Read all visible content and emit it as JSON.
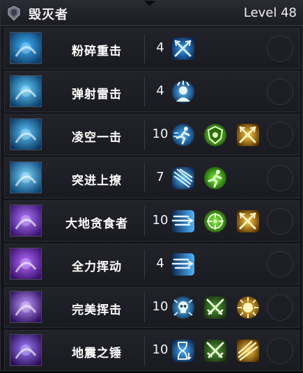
{
  "header": {
    "title": "毁灭者",
    "level": "Level 48"
  },
  "skills": [
    {
      "name": "粉碎重击",
      "value": "4",
      "colors": [
        "#0d3b66",
        "#3fb7ff"
      ],
      "modifiers": [
        "crossed-arrows-icon"
      ]
    },
    {
      "name": "弹射雷击",
      "value": "4",
      "colors": [
        "#0b3f6e",
        "#66d0ff"
      ],
      "modifiers": [
        "stun-head-icon"
      ]
    },
    {
      "name": "凌空一击",
      "value": "10",
      "colors": [
        "#0a3660",
        "#5cc8ff"
      ],
      "modifiers": [
        "running-figure-icon",
        "green-shield-icon",
        "gold-crossed-arrows-icon"
      ]
    },
    {
      "name": "突进上撩",
      "value": "7",
      "colors": [
        "#0d4578",
        "#7ad6ff"
      ],
      "modifiers": [
        "streak-lines-icon",
        "green-runner-icon"
      ]
    },
    {
      "name": "大地贪食者",
      "value": "10",
      "colors": [
        "#3a1170",
        "#b07cff"
      ],
      "modifiers": [
        "speed-lines-icon",
        "green-target-icon",
        "gold-crossed-arrows-icon"
      ]
    },
    {
      "name": "全力挥动",
      "value": "4",
      "colors": [
        "#3c0f6e",
        "#b46cff"
      ],
      "modifiers": [
        "speed-lines-icon"
      ]
    },
    {
      "name": "完美挥击",
      "value": "10",
      "colors": [
        "#2a0f60",
        "#c59bff"
      ],
      "modifiers": [
        "skull-burst-icon",
        "green-crossed-swords-icon",
        "gold-sunburst-icon"
      ]
    },
    {
      "name": "地震之锤",
      "value": "10",
      "colors": [
        "#2b0d58",
        "#9d7cff"
      ],
      "modifiers": [
        "hourglass-icon",
        "green-crossed-swords-icon",
        "gold-streak-icon"
      ]
    }
  ]
}
